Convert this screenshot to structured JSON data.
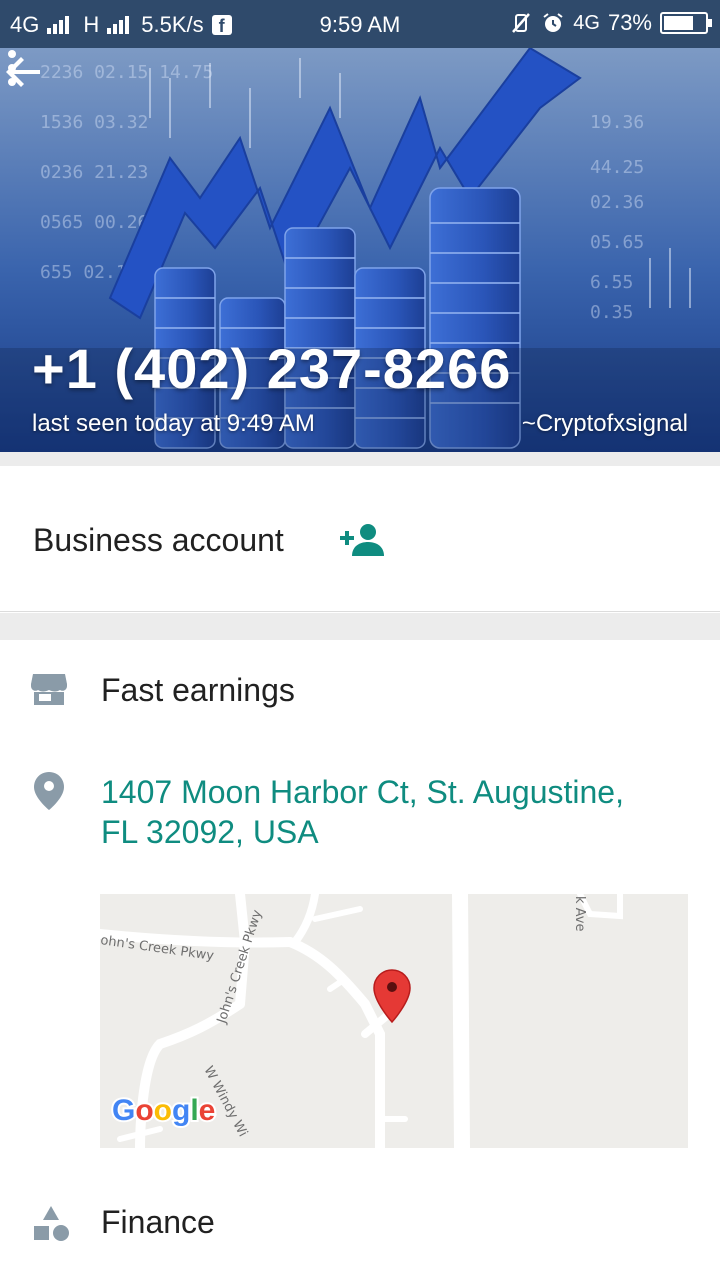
{
  "status_bar": {
    "network_1": "4G",
    "network_2": "H",
    "speed": "5.5K/s",
    "time": "9:59 AM",
    "network_3": "4G",
    "battery": "73%",
    "battery_level": 0.73
  },
  "header": {
    "phone": "+1 (402) 237-8266",
    "last_seen": "last seen today at 9:49 AM",
    "pushname": "~Cryptofxsignal",
    "background": "blue finance chart with bar columns and rising zigzag line",
    "icons": {
      "back": "arrow-back-icon",
      "menu": "more-vert-icon"
    }
  },
  "business": {
    "label": "Business account",
    "icon": "person-add-icon"
  },
  "details": {
    "category": "Fast earnings",
    "category_icon": "store-icon",
    "address_line1": "1407 Moon Harbor Ct, St. Augustine,",
    "address_line2": "FL 32092, USA",
    "address_icon": "location-pin-icon",
    "map": {
      "labels": [
        "ohn's Creek Pkwy",
        "John's Creek Pkwy",
        "W Windy Wi",
        "k Ave"
      ],
      "brand": "Google"
    },
    "business_type": "Finance",
    "business_type_icon": "category-shapes-icon"
  },
  "colors": {
    "accent": "#0f8c80",
    "status_bar": "#2f4a6b",
    "icon_grey": "#8a9ba8",
    "map_pin": "#e53935"
  }
}
